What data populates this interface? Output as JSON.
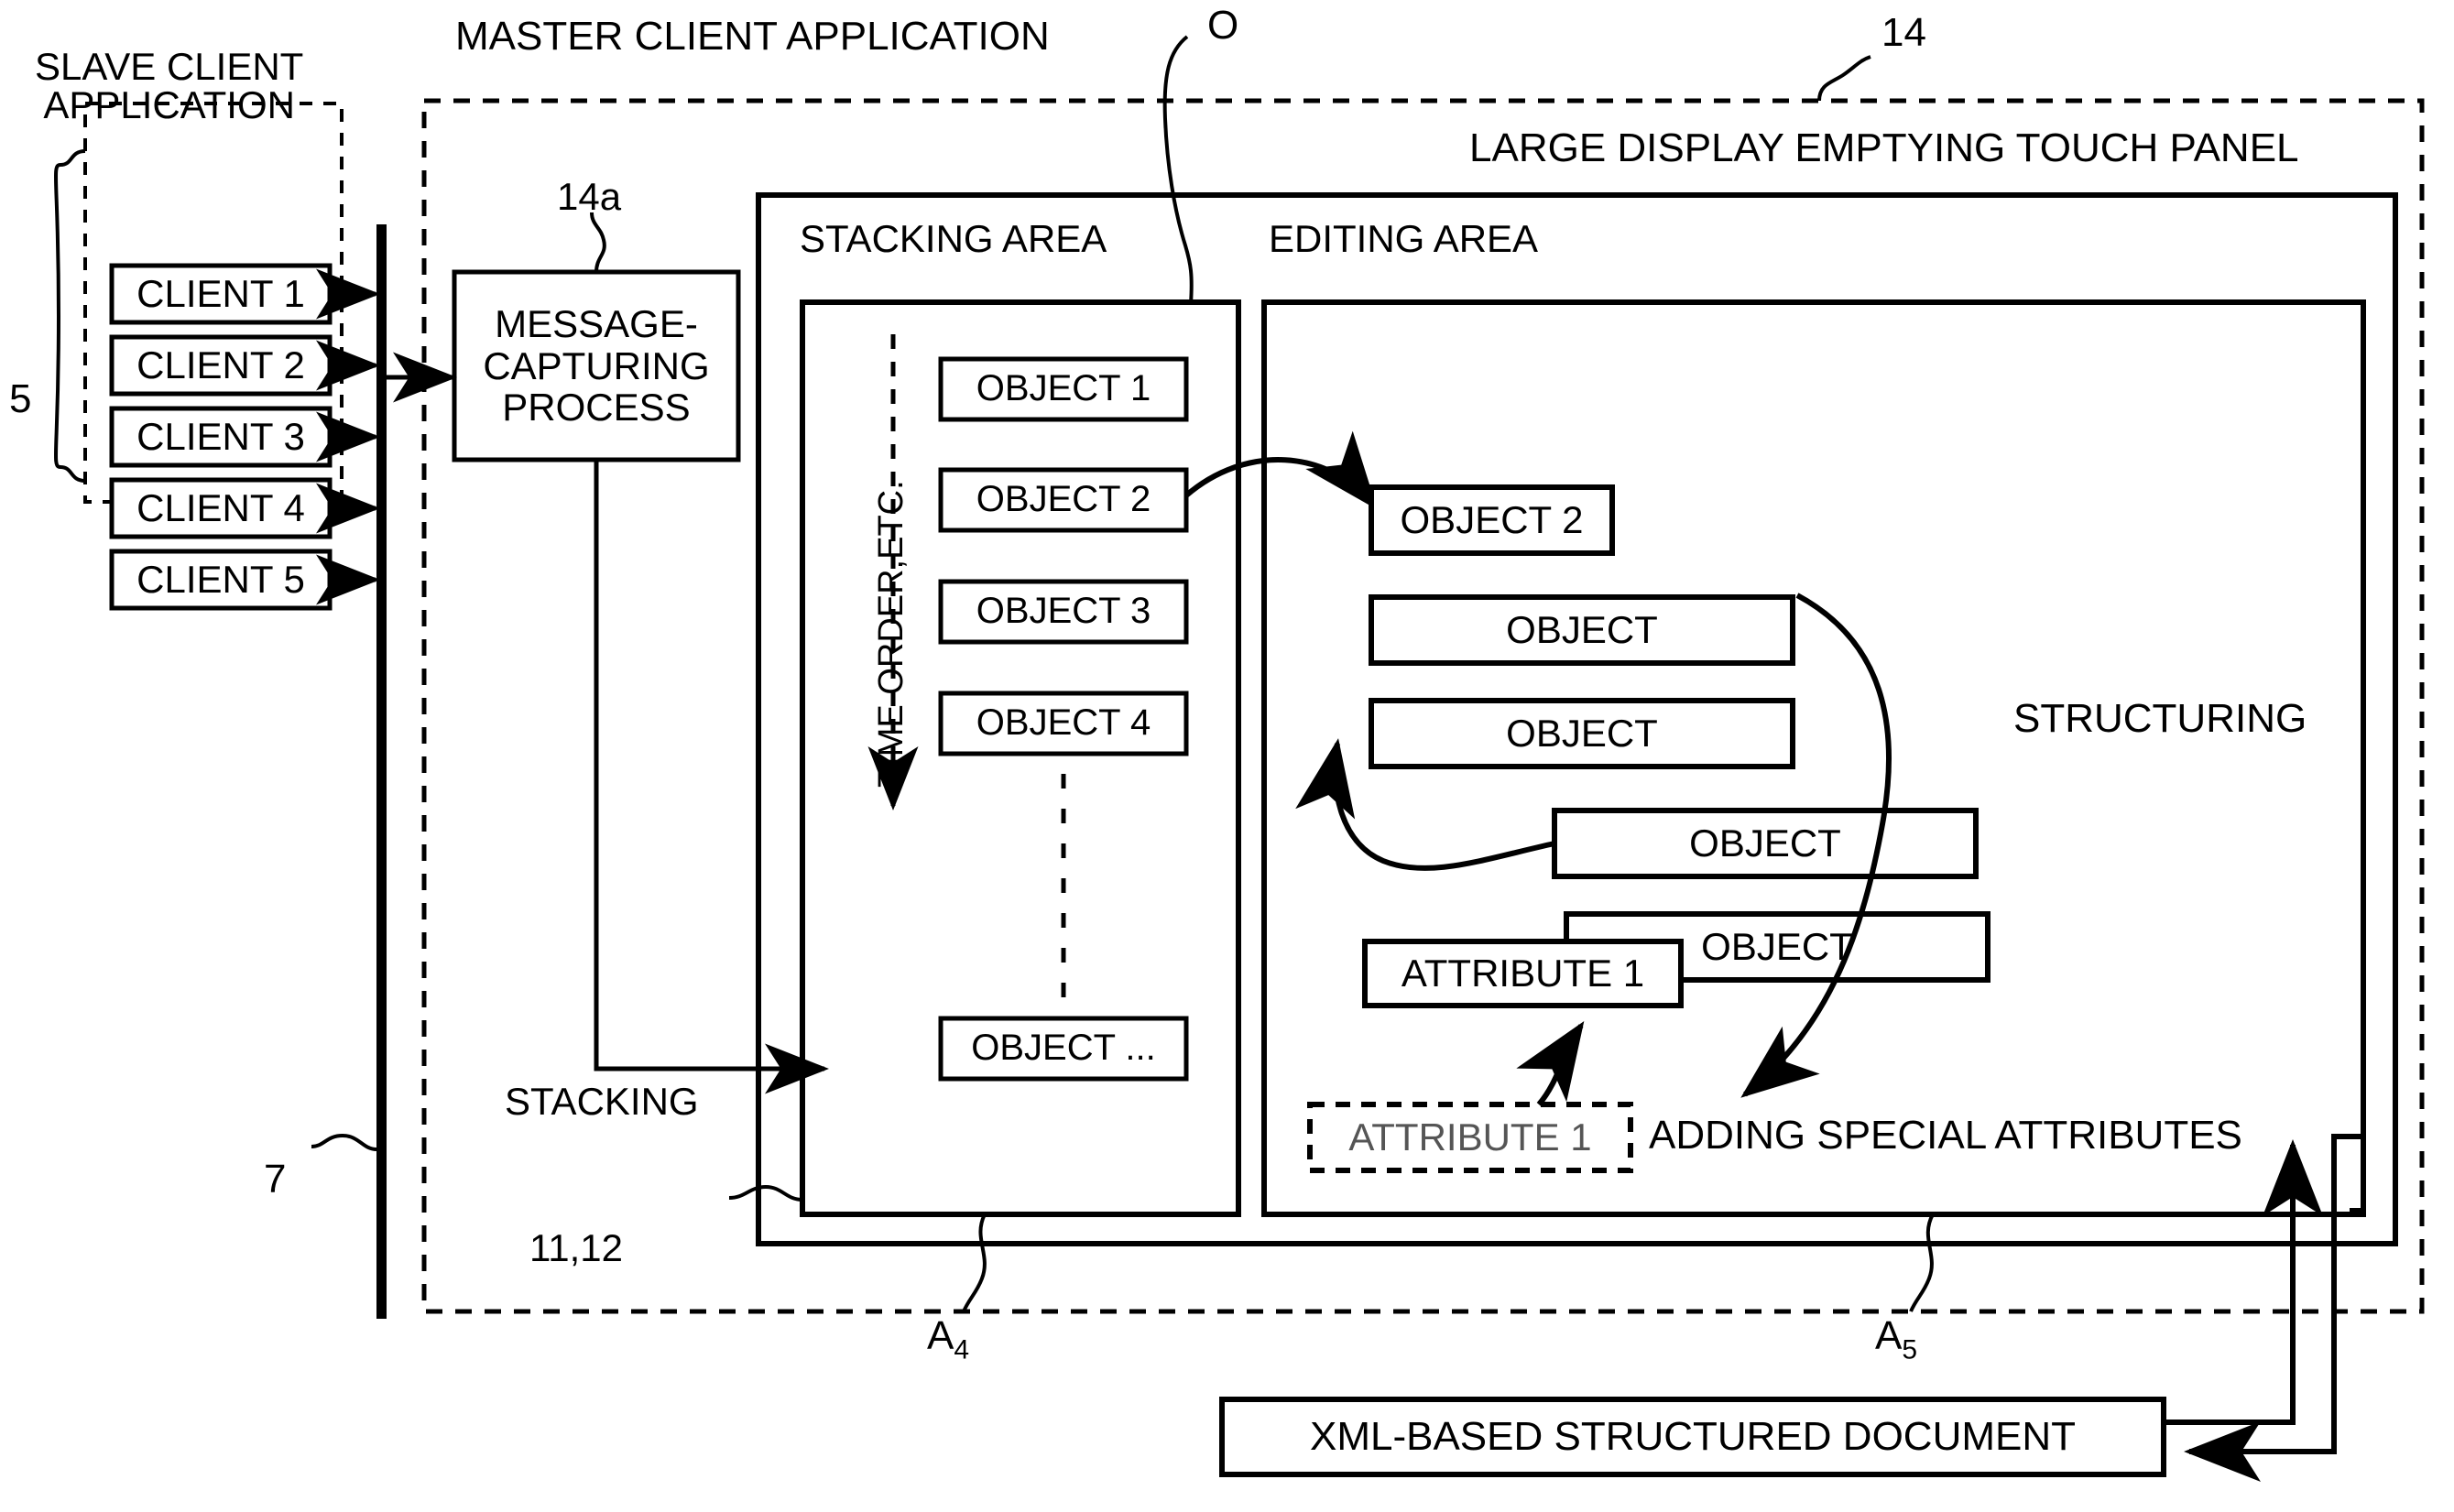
{
  "figure": {
    "type": "patent-block-diagram",
    "headings": {
      "slave_client_application": "SLAVE CLIENT\nAPPLICATION",
      "master_client_application": "MASTER CLIENT APPLICATION",
      "large_display": "LARGE DISPLAY EMPTYING TOUCH PANEL",
      "stacking_area": "STACKING AREA",
      "editing_area": "EDITING AREA"
    },
    "reference_numerals": {
      "clients_group": "5",
      "network_bus": "7",
      "message_capturing_process": "14a",
      "large_display_panel": "14",
      "object_pointer": "O",
      "stacking_inner": "11,12",
      "stacking_area_ref": "A",
      "stacking_area_ref_sub": "4",
      "editing_area_ref": "A",
      "editing_area_ref_sub": "5"
    },
    "clients": [
      {
        "label": "CLIENT 1"
      },
      {
        "label": "CLIENT 2"
      },
      {
        "label": "CLIENT 3"
      },
      {
        "label": "CLIENT 4"
      },
      {
        "label": "CLIENT 5"
      }
    ],
    "process_box": {
      "label": "MESSAGE-\nCAPTURING\nPROCESS"
    },
    "stacking": {
      "axis_label": "TIME ORDER,ETC.",
      "flow_label": "STACKING",
      "objects": [
        {
          "label": "OBJECT 1"
        },
        {
          "label": "OBJECT 2"
        },
        {
          "label": "OBJECT 3"
        },
        {
          "label": "OBJECT 4"
        },
        {
          "label": "OBJECT ..."
        }
      ]
    },
    "editing": {
      "objects": [
        {
          "label": "OBJECT 2"
        },
        {
          "label": "OBJECT"
        },
        {
          "label": "OBJECT"
        },
        {
          "label": "OBJECT"
        },
        {
          "label": "OBJECT"
        }
      ],
      "attribute_solid": "ATTRIBUTE 1",
      "attribute_dashed": "ATTRIBUTE 1",
      "structuring_label": "STRUCTURING",
      "adding_attributes_label": "ADDING SPECIAL ATTRIBUTES"
    },
    "output_box": {
      "label": "XML-BASED STRUCTURED DOCUMENT"
    },
    "colors": {
      "ink": "#000000",
      "paper": "#ffffff"
    }
  }
}
